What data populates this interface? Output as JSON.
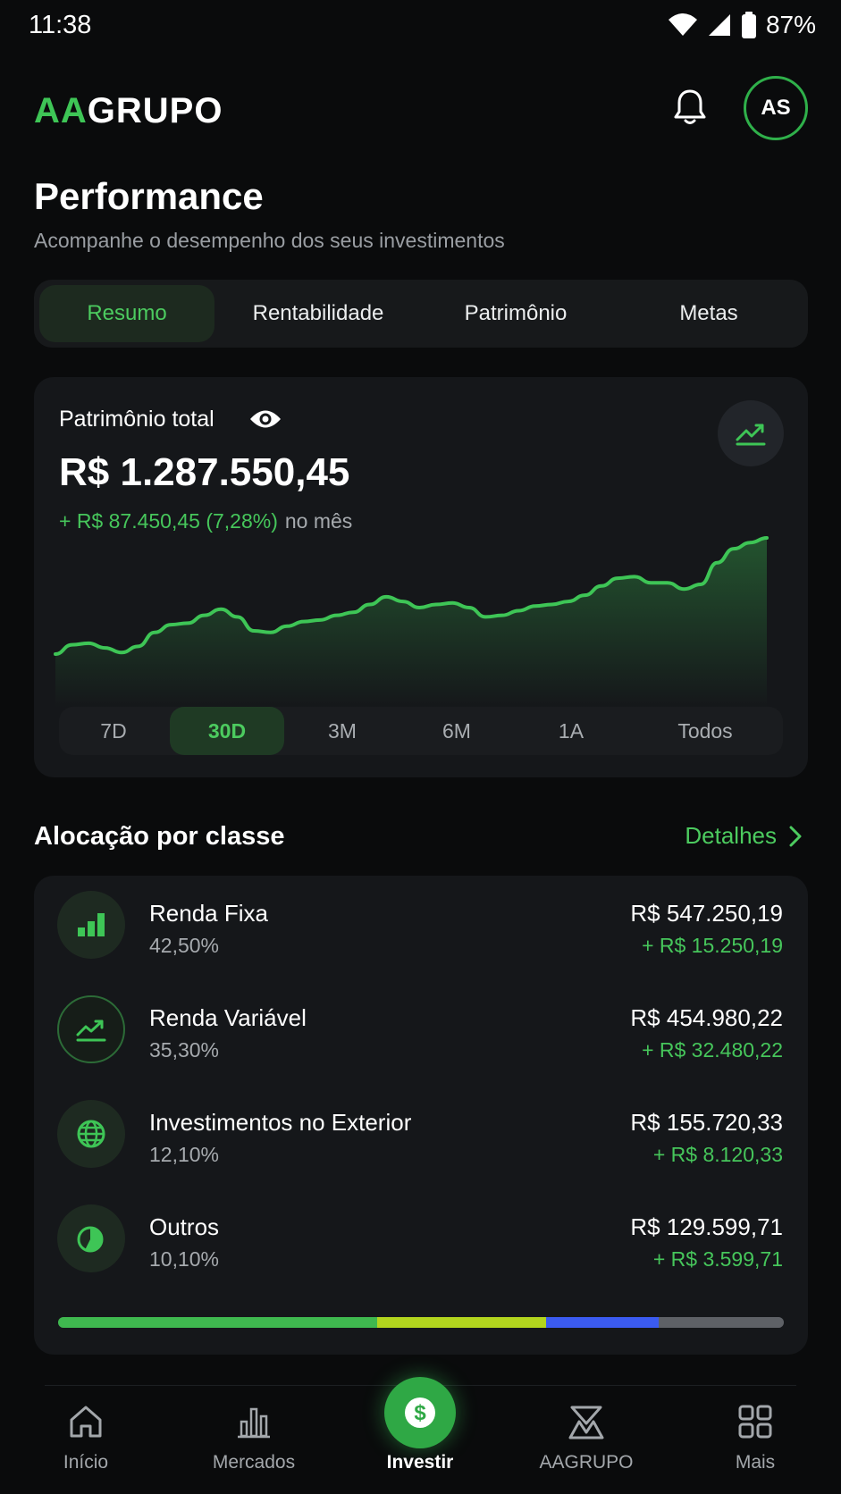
{
  "status_bar": {
    "time": "11:38",
    "battery": "87%"
  },
  "header": {
    "logo_accent": "AA",
    "logo_rest": "GRUPO",
    "avatar_initials": "AS"
  },
  "page": {
    "title": "Performance",
    "subtitle": "Acompanhe o desempenho dos seus investimentos"
  },
  "tabs": [
    {
      "label": "Resumo",
      "active": true
    },
    {
      "label": "Rentabilidade",
      "active": false
    },
    {
      "label": "Patrimônio",
      "active": false
    },
    {
      "label": "Metas",
      "active": false
    }
  ],
  "performance": {
    "label": "Patrimônio total",
    "value": "R$ 1.287.550,45",
    "change": "+ R$ 87.450,45 (7,28%)",
    "period": "no mês"
  },
  "chart_data": {
    "type": "area",
    "title": "",
    "xlabel": "",
    "ylabel": "",
    "series": [
      {
        "values": [
          40,
          46,
          47,
          44,
          41,
          45,
          54,
          59,
          60,
          65,
          69,
          64,
          55,
          54,
          58,
          61,
          62,
          65,
          67,
          72,
          77,
          74,
          70,
          72,
          73,
          70,
          64,
          65,
          68,
          71,
          72,
          74,
          78,
          84,
          89,
          90,
          86,
          86,
          82,
          85,
          99,
          108,
          112,
          115
        ]
      }
    ],
    "grid": false,
    "legend": "none",
    "color": "#3ec556"
  },
  "ranges": [
    {
      "label": "7D",
      "active": false
    },
    {
      "label": "30D",
      "active": true
    },
    {
      "label": "3M",
      "active": false
    },
    {
      "label": "6M",
      "active": false
    },
    {
      "label": "1A",
      "active": false
    },
    {
      "label": "Todos",
      "active": false
    }
  ],
  "allocation": {
    "title": "Alocação por classe",
    "details_label": "Detalhes",
    "items": [
      {
        "name": "Renda Fixa",
        "pct": "42,50%",
        "value": "R$ 547.250,19",
        "gain": "+ R$ 15.250,19",
        "icon": "bar-chart-icon"
      },
      {
        "name": "Renda Variável",
        "pct": "35,30%",
        "value": "R$ 454.980,22",
        "gain": "+ R$ 32.480,22",
        "icon": "trend-up-icon"
      },
      {
        "name": "Investimentos no Exterior",
        "pct": "12,10%",
        "value": "R$ 155.720,33",
        "gain": "+ R$ 8.120,33",
        "icon": "globe-icon"
      },
      {
        "name": "Outros",
        "pct": "10,10%",
        "value": "R$ 129.599,71",
        "gain": "+ R$ 3.599,71",
        "icon": "pie-chart-icon"
      }
    ],
    "bar_segments": [
      {
        "share": 0.44,
        "color": "#3fb84f"
      },
      {
        "share": 0.233,
        "color": "#b2d41e"
      },
      {
        "share": 0.155,
        "color": "#3b5bf0"
      },
      {
        "share": 0.172,
        "color": "#5e6166"
      }
    ]
  },
  "nav": [
    {
      "label": "Início",
      "icon": "home-icon",
      "active": false
    },
    {
      "label": "Mercados",
      "icon": "bar-chart-icon",
      "active": false
    },
    {
      "label": "Investir",
      "icon": "dollar-icon",
      "active": true
    },
    {
      "label": "AAGRUPO",
      "icon": "aagrupo-logo-icon",
      "active": false
    },
    {
      "label": "Mais",
      "icon": "grid-icon",
      "active": false
    }
  ],
  "colors": {
    "accent": "#3ec556",
    "background": "#0a0b0c",
    "card": "#15171a"
  }
}
